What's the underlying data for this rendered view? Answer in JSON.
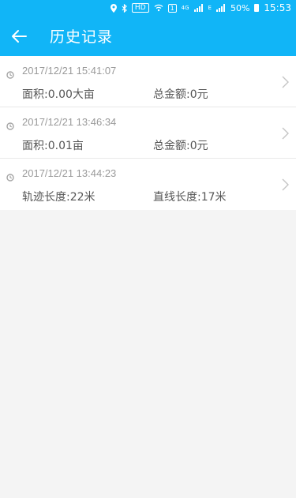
{
  "statusbar": {
    "hd": "HD",
    "sim": "1",
    "net": "4G",
    "signal_label": "E",
    "battery": "50%",
    "time": "15:53"
  },
  "header": {
    "title": "历史记录"
  },
  "records": [
    {
      "datetime": "2017/12/21 15:41:07",
      "left": "面积:0.00大亩",
      "right": "总金额:0元"
    },
    {
      "datetime": "2017/12/21 13:46:34",
      "left": "面积:0.01亩",
      "right": "总金额:0元"
    },
    {
      "datetime": "2017/12/21 13:44:23",
      "left": "轨迹长度:22米",
      "right": "直线长度:17米"
    }
  ]
}
